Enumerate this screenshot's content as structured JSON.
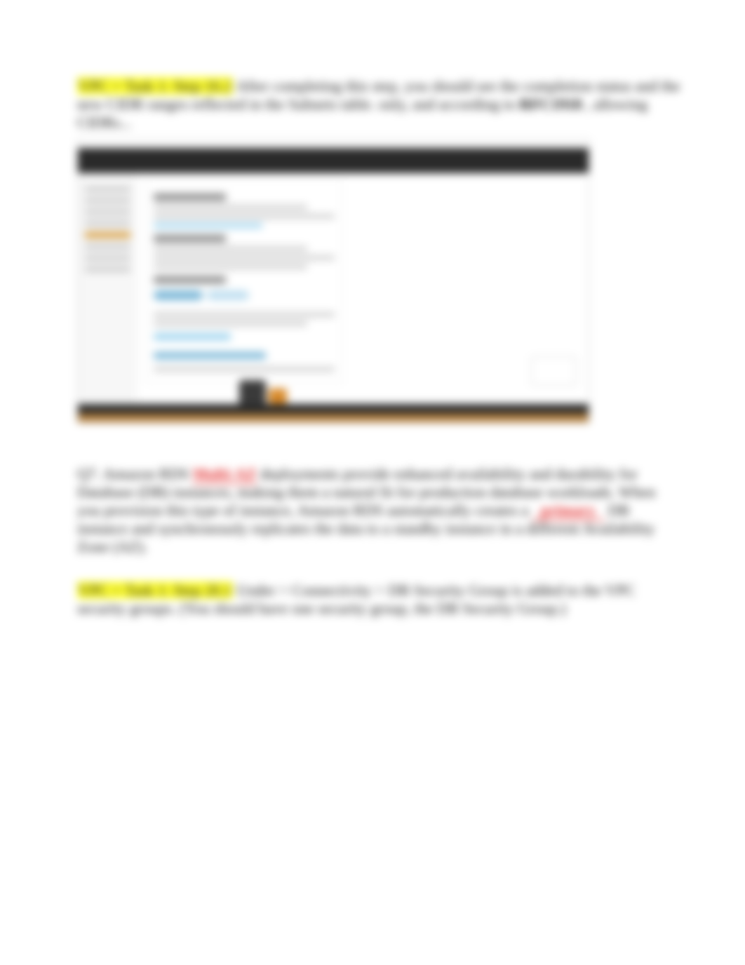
{
  "para1": {
    "highlight": "VPC > Task 1: Step 16.2",
    "rest": "After completing this step, you should see the completion status and the new CIDR ranges reflected in the Subnets table. ",
    "tail": "only, and according to ",
    "bolded": "RFC1918",
    "after_bold": ", allowing CIDRs..."
  },
  "para2": {
    "lead": "Q7. Amazon RDS ",
    "blank1": "Multi-AZ",
    "mid": " deployments provide enhanced availability and durability for Database (DB) instances, making them a natural fit for production database workloads. When you provision this type of instance, Amazon RDS automatically creates a ",
    "blank2": "primary",
    "tail": " DB instance and synchronously replicates the data to a standby instance in a different Availability Zone (AZ)."
  },
  "para3": {
    "highlight": "VPC > Task 1: Step 20.1",
    "body": "Under > Connectivity > DB Security Group is added to the VPC security groups. (You should have one security group, the DB Security Group.)"
  },
  "screenshot": {
    "topbar": "aws console top bar",
    "left_nav_items": [
      "VPC",
      "Subnets",
      "Route Tables",
      "Gateways",
      "Peering",
      "Security",
      "Endpoints"
    ],
    "panel_title": "Create subnet",
    "panel_region": "us-east-1a",
    "panel_zone": "Availability Zone",
    "panel_cidr_label": "IPv4 CIDR block",
    "panel_cidr": "10.0.1.0/24",
    "panel_add": "Add new subnet",
    "panel_additional": "Additional settings",
    "feedback_label": "Feedback"
  }
}
